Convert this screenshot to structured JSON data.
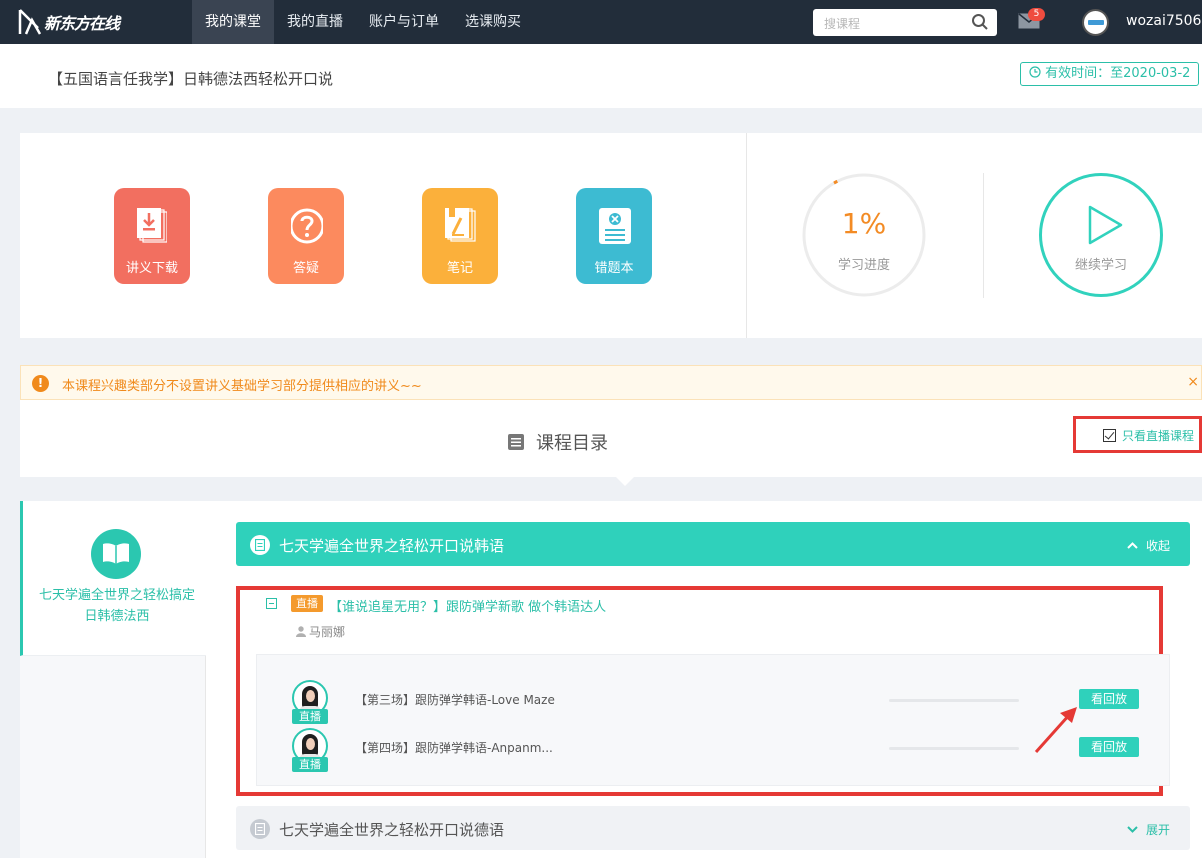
{
  "brand": {
    "logo_text": "新东方在线"
  },
  "nav": {
    "items": [
      {
        "label": "我的课堂"
      },
      {
        "label": "我的直播"
      },
      {
        "label": "账户与订单"
      },
      {
        "label": "选课购买"
      }
    ]
  },
  "search": {
    "placeholder": "搜课程"
  },
  "user": {
    "mail_count": "5",
    "name": "wozai7506"
  },
  "course": {
    "title": "【五国语言任我学】日韩德法西轻松开口说",
    "valid_text": "有效时间：至2020-03-2"
  },
  "tools": [
    {
      "label": "讲义下载",
      "icon": "download-doc-icon"
    },
    {
      "label": "答疑",
      "icon": "question-icon"
    },
    {
      "label": "笔记",
      "icon": "notebook-icon"
    },
    {
      "label": "错题本",
      "icon": "error-book-icon"
    }
  ],
  "progress": {
    "percent_text": "1%",
    "label": "学习进度",
    "value": 0.01
  },
  "continue": {
    "label": "继续学习"
  },
  "notice": {
    "text": "本课程兴趣类部分不设置讲义基础学习部分提供相应的讲义~~",
    "close": "×"
  },
  "catalog": {
    "title": "课程目录",
    "filter_label": "只看直播课程"
  },
  "sidebar": {
    "active_item": "七天学遍全世界之轻松搞定日韩德法西"
  },
  "chapters": [
    {
      "title": "七天学遍全世界之轻松开口说韩语",
      "toggle": "收起"
    },
    {
      "title": "七天学遍全世界之轻松开口说德语",
      "toggle": "展开"
    }
  ],
  "lesson": {
    "tag": "直播",
    "title": "【谁说追星无用？】跟防弹学新歌 做个韩语达人",
    "teacher": "马丽娜"
  },
  "sessions": [
    {
      "tag": "直播",
      "title": "【第三场】跟防弹学韩语-Love Maze",
      "button": "看回放"
    },
    {
      "tag": "直播",
      "title": "【第四场】跟防弹学韩语-Anpanm...",
      "button": "看回放"
    }
  ],
  "colors": {
    "accent": "#2fd1bb",
    "nav_bg": "#222d3a",
    "orange": "#f38b24",
    "annotation_red": "#e53935"
  }
}
